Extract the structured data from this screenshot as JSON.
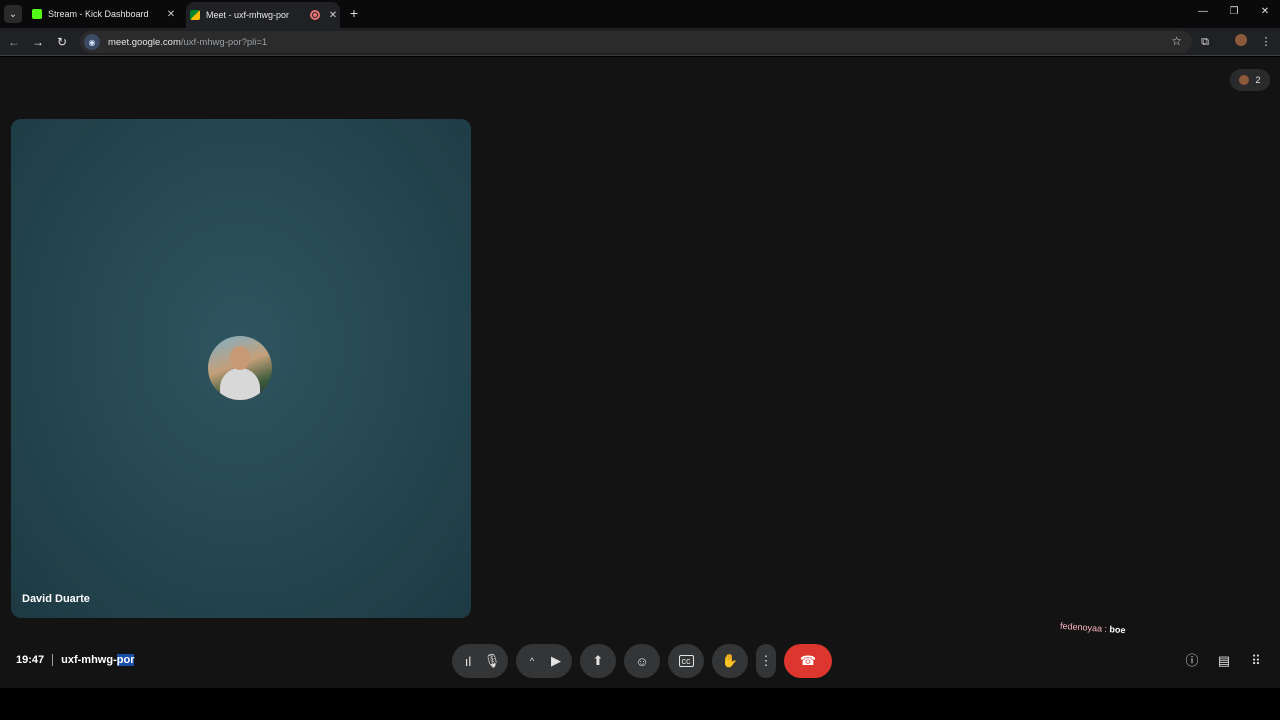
{
  "browser": {
    "tabs": [
      {
        "title": "Stream - Kick Dashboard",
        "favicon_color": "#53fc18"
      },
      {
        "title": "Meet - uxf-mhwg-por",
        "favicon_color": "#00832d"
      }
    ],
    "tab_search_glyph": "⌄",
    "new_tab_glyph": "+",
    "window_controls": {
      "minimize": "—",
      "restore": "❐",
      "close": "✕"
    },
    "address": {
      "host": "meet.google.com",
      "path": "/uxf-mhwg-por?pli=1"
    }
  },
  "meet": {
    "participant_count": "2",
    "tile": {
      "name": "David Duarte",
      "background": "#274952"
    },
    "chat_overlay": {
      "user": "fedenoyaa :",
      "message": "boe"
    },
    "clock": "19:47",
    "meeting_code_prefix": "uxf-mhwg-",
    "meeting_code_selected": "por",
    "end_call_color": "#dc362e"
  }
}
